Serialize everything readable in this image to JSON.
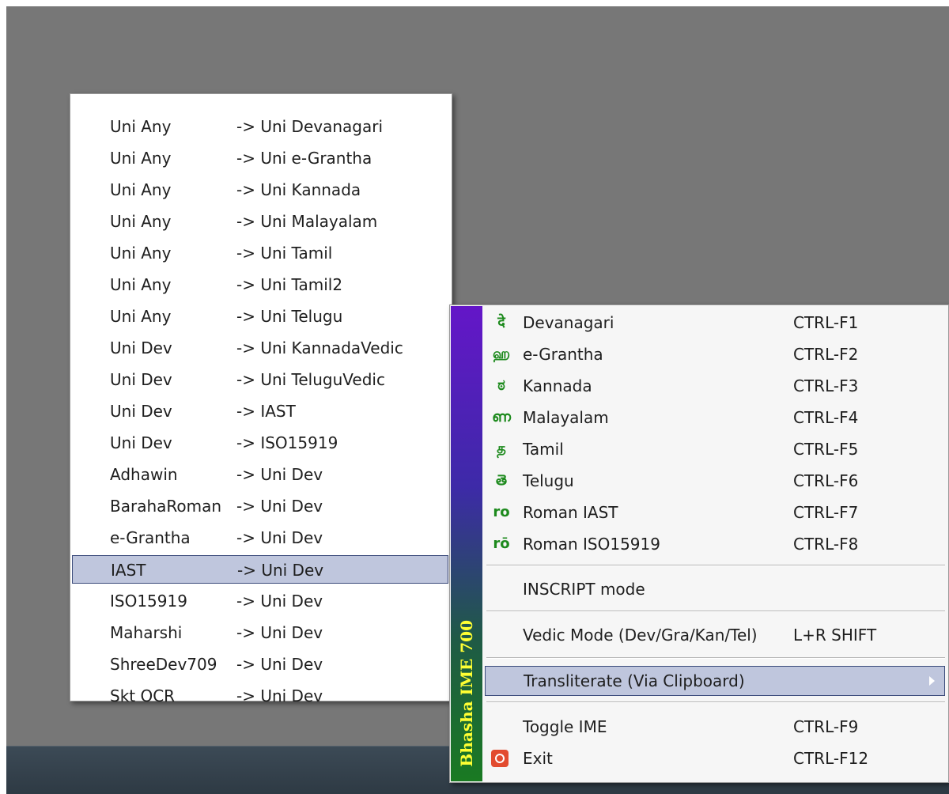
{
  "submenu": {
    "items": [
      {
        "source": "Uni Any",
        "target": "-> Uni Devanagari"
      },
      {
        "source": "Uni Any",
        "target": "-> Uni e-Grantha"
      },
      {
        "source": "Uni Any",
        "target": "-> Uni Kannada"
      },
      {
        "source": "Uni Any",
        "target": "-> Uni Malayalam"
      },
      {
        "source": "Uni Any",
        "target": "-> Uni Tamil"
      },
      {
        "source": "Uni Any",
        "target": "-> Uni Tamil2"
      },
      {
        "source": "Uni Any",
        "target": "-> Uni Telugu"
      },
      {
        "source": "Uni Dev",
        "target": "-> Uni KannadaVedic"
      },
      {
        "source": "Uni Dev",
        "target": "-> Uni TeluguVedic"
      },
      {
        "source": "Uni Dev",
        "target": "-> IAST"
      },
      {
        "source": "Uni Dev",
        "target": "-> ISO15919"
      },
      {
        "source": "Adhawin",
        "target": "-> Uni Dev"
      },
      {
        "source": "BarahaRoman",
        "target": "-> Uni Dev"
      },
      {
        "source": "e-Grantha",
        "target": "-> Uni Dev"
      },
      {
        "source": "IAST",
        "target": "-> Uni Dev"
      },
      {
        "source": "ISO15919",
        "target": "-> Uni Dev"
      },
      {
        "source": "Maharshi",
        "target": "-> Uni Dev"
      },
      {
        "source": "ShreeDev709",
        "target": "-> Uni Dev"
      },
      {
        "source": "Skt OCR",
        "target": "-> Uni Dev"
      }
    ],
    "selected_index": 14
  },
  "mainmenu": {
    "brand": "Bhasha IME 700",
    "scripts": [
      {
        "glyph": "दे",
        "icon": "devanagari-icon",
        "label": "Devanagari",
        "shortcut": "CTRL-F1"
      },
      {
        "glyph": "ஹ",
        "icon": "egrantha-icon",
        "label": "e-Grantha",
        "shortcut": "CTRL-F2"
      },
      {
        "glyph": "ಠ",
        "icon": "kannada-icon",
        "label": "Kannada",
        "shortcut": "CTRL-F3"
      },
      {
        "glyph": "ണ",
        "icon": "malayalam-icon",
        "label": "Malayalam",
        "shortcut": "CTRL-F4"
      },
      {
        "glyph": "த",
        "icon": "tamil-icon",
        "label": "Tamil",
        "shortcut": "CTRL-F5"
      },
      {
        "glyph": "తె",
        "icon": "telugu-icon",
        "label": "Telugu",
        "shortcut": "CTRL-F6"
      },
      {
        "glyph": "ro",
        "icon": "roman-iast-icon",
        "label": "Roman IAST",
        "shortcut": "CTRL-F7"
      },
      {
        "glyph": "rō",
        "icon": "roman-iso-icon",
        "label": "Roman ISO15919",
        "shortcut": "CTRL-F8"
      }
    ],
    "inscript": {
      "label": "INSCRIPT mode"
    },
    "vedic": {
      "label": "Vedic Mode (Dev/Gra/Kan/Tel)",
      "shortcut": "L+R SHIFT"
    },
    "transliterate": {
      "label": "Transliterate (Via Clipboard)"
    },
    "toggle": {
      "label": "Toggle IME",
      "shortcut": "CTRL-F9"
    },
    "exit": {
      "label": "Exit",
      "shortcut": "CTRL-F12"
    }
  },
  "colors": {
    "selection": "#bfc6dd",
    "icon_green": "#1d8a1d",
    "brand_text": "#ffff33"
  }
}
